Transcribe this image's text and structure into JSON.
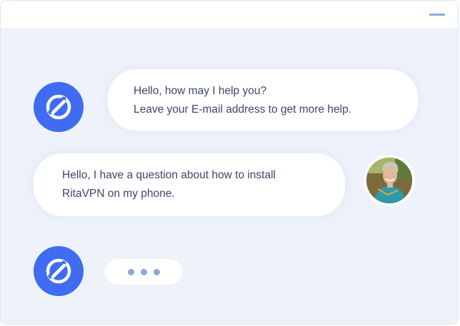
{
  "window": {
    "minimize_label": "minimize"
  },
  "chat": {
    "messages": [
      {
        "sender": "bot",
        "lines": [
          "Hello, how may I help you?",
          "Leave your E-mail address to get more help."
        ]
      },
      {
        "sender": "user",
        "lines": [
          "Hello, I have a question about how to install",
          "RitaVPN on my phone."
        ]
      },
      {
        "sender": "bot",
        "typing": true
      }
    ]
  },
  "colors": {
    "accent": "#3f6cf0",
    "background": "#eef2fa",
    "bubble": "#ffffff",
    "text": "#3d4766",
    "typing_dot": "#8fa6df"
  },
  "icons": {
    "bot_avatar": "link-logo-icon",
    "user_avatar": "user-photo",
    "minimize": "minimize-icon"
  }
}
